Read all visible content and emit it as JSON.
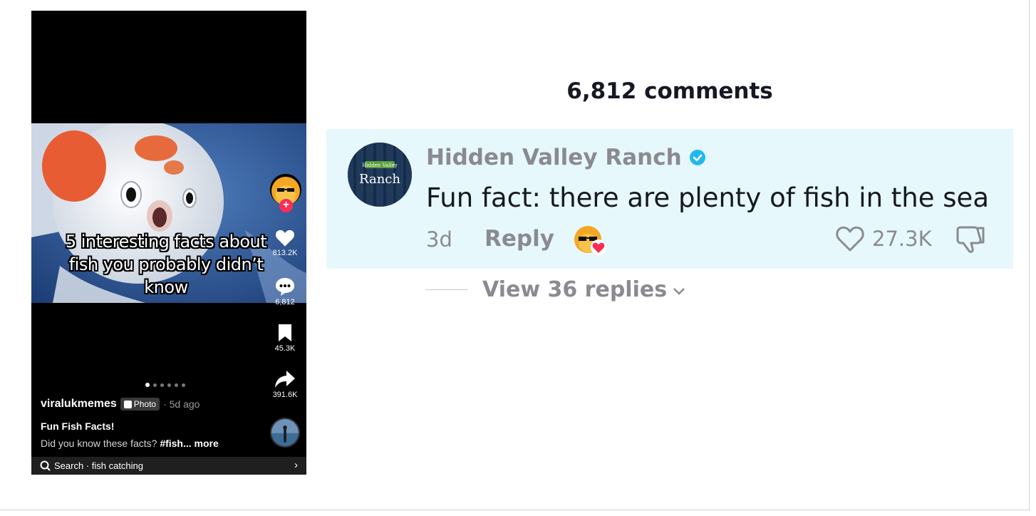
{
  "video": {
    "caption": "5 interesting facts about fish you probably didn’t know",
    "actions": {
      "likes": "813.2K",
      "comments": "6,812",
      "saves": "45.3K",
      "shares": "391.6K"
    },
    "carousel": {
      "total": 6,
      "active": 1
    },
    "username": "viralukmemes",
    "badge": "Photo",
    "posted": "· 5d ago",
    "title": "Fun Fish Facts!",
    "description": "Did you know these facts? ",
    "description_tag": "#fish... more",
    "search_text": "Search · fish catching",
    "search_chevron": "›",
    "follow_plus": "+"
  },
  "comments": {
    "title": "6,812 comments",
    "items": [
      {
        "author": "Hidden Valley Ranch",
        "avatar_logo_top": "Hidden Valley",
        "avatar_logo_main": "Ranch",
        "verified": true,
        "text": "Fun fact: there are plenty of fish in the sea",
        "time": "3d",
        "reply_label": "Reply",
        "likes": "27.3K",
        "view_replies": "View 36 replies"
      }
    ]
  },
  "colors": {
    "highlight": "#e6f8fc",
    "follow": "#fe2c55",
    "verified": "#20b9ef",
    "muted": "#8a8b91"
  },
  "icons": [
    "heart-icon",
    "comment-icon",
    "bookmark-icon",
    "share-icon",
    "search-icon",
    "chevron-right-icon",
    "verified-icon",
    "dislike-icon",
    "chevron-down-icon"
  ]
}
